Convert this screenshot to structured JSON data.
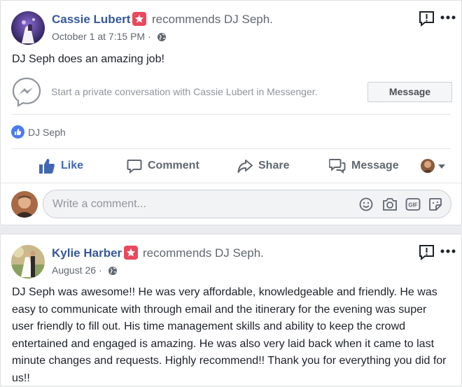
{
  "post1": {
    "author": "Cassie Lubert",
    "action_text": "recommends DJ Seph.",
    "timestamp": "October 1 at 7:15 PM · ",
    "body": "DJ Seph does an amazing job!",
    "messenger_prompt": "Start a private conversation with Cassie Lubert in Messenger.",
    "message_button": "Message",
    "reaction_name": "DJ Seph",
    "actions": {
      "like": "Like",
      "comment": "Comment",
      "share": "Share",
      "message": "Message"
    },
    "comment_placeholder": "Write a comment..."
  },
  "post2": {
    "author": "Kylie Harber",
    "action_text": "recommends DJ Seph.",
    "timestamp": "August 26 · ",
    "body": "DJ Seph was awesome!! He was very affordable, knowledgeable and friendly. He was easy to communicate with through email and the itinerary for the evening was super user friendly to fill out. His time management skills and ability to keep the crowd entertained and engaged is amazing. He was also very laid back when it came to last minute changes and requests. Highly recommend!! Thank you for everything you did for us!!"
  },
  "colors": {
    "link": "#365899",
    "like_blue": "#4267b2",
    "badge": "#e9485d"
  }
}
